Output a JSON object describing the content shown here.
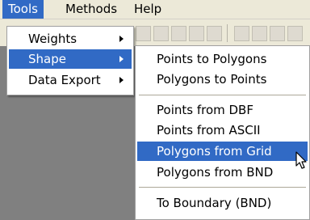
{
  "menubar": {
    "items": [
      {
        "label": "Tools"
      },
      {
        "label": "Methods"
      },
      {
        "label": "Help"
      }
    ]
  },
  "tools_menu": {
    "items": [
      {
        "label": "Weights"
      },
      {
        "label": "Shape"
      },
      {
        "label": "Data Export"
      }
    ]
  },
  "shape_submenu": {
    "items": [
      {
        "label": "Points to Polygons"
      },
      {
        "label": "Polygons to Points"
      },
      {
        "label": "Points from DBF"
      },
      {
        "label": "Points from ASCII"
      },
      {
        "label": "Polygons from Grid"
      },
      {
        "label": "Polygons from BND"
      },
      {
        "label": "To Boundary (BND)"
      }
    ]
  },
  "colors": {
    "highlight": "#316ac5",
    "menu_background": "#ffffff",
    "app_background": "#808080",
    "chrome": "#ece9d8"
  },
  "icons": [
    "submenu-arrow-icon",
    "toolbar-icon",
    "mouse-pointer-icon"
  ]
}
